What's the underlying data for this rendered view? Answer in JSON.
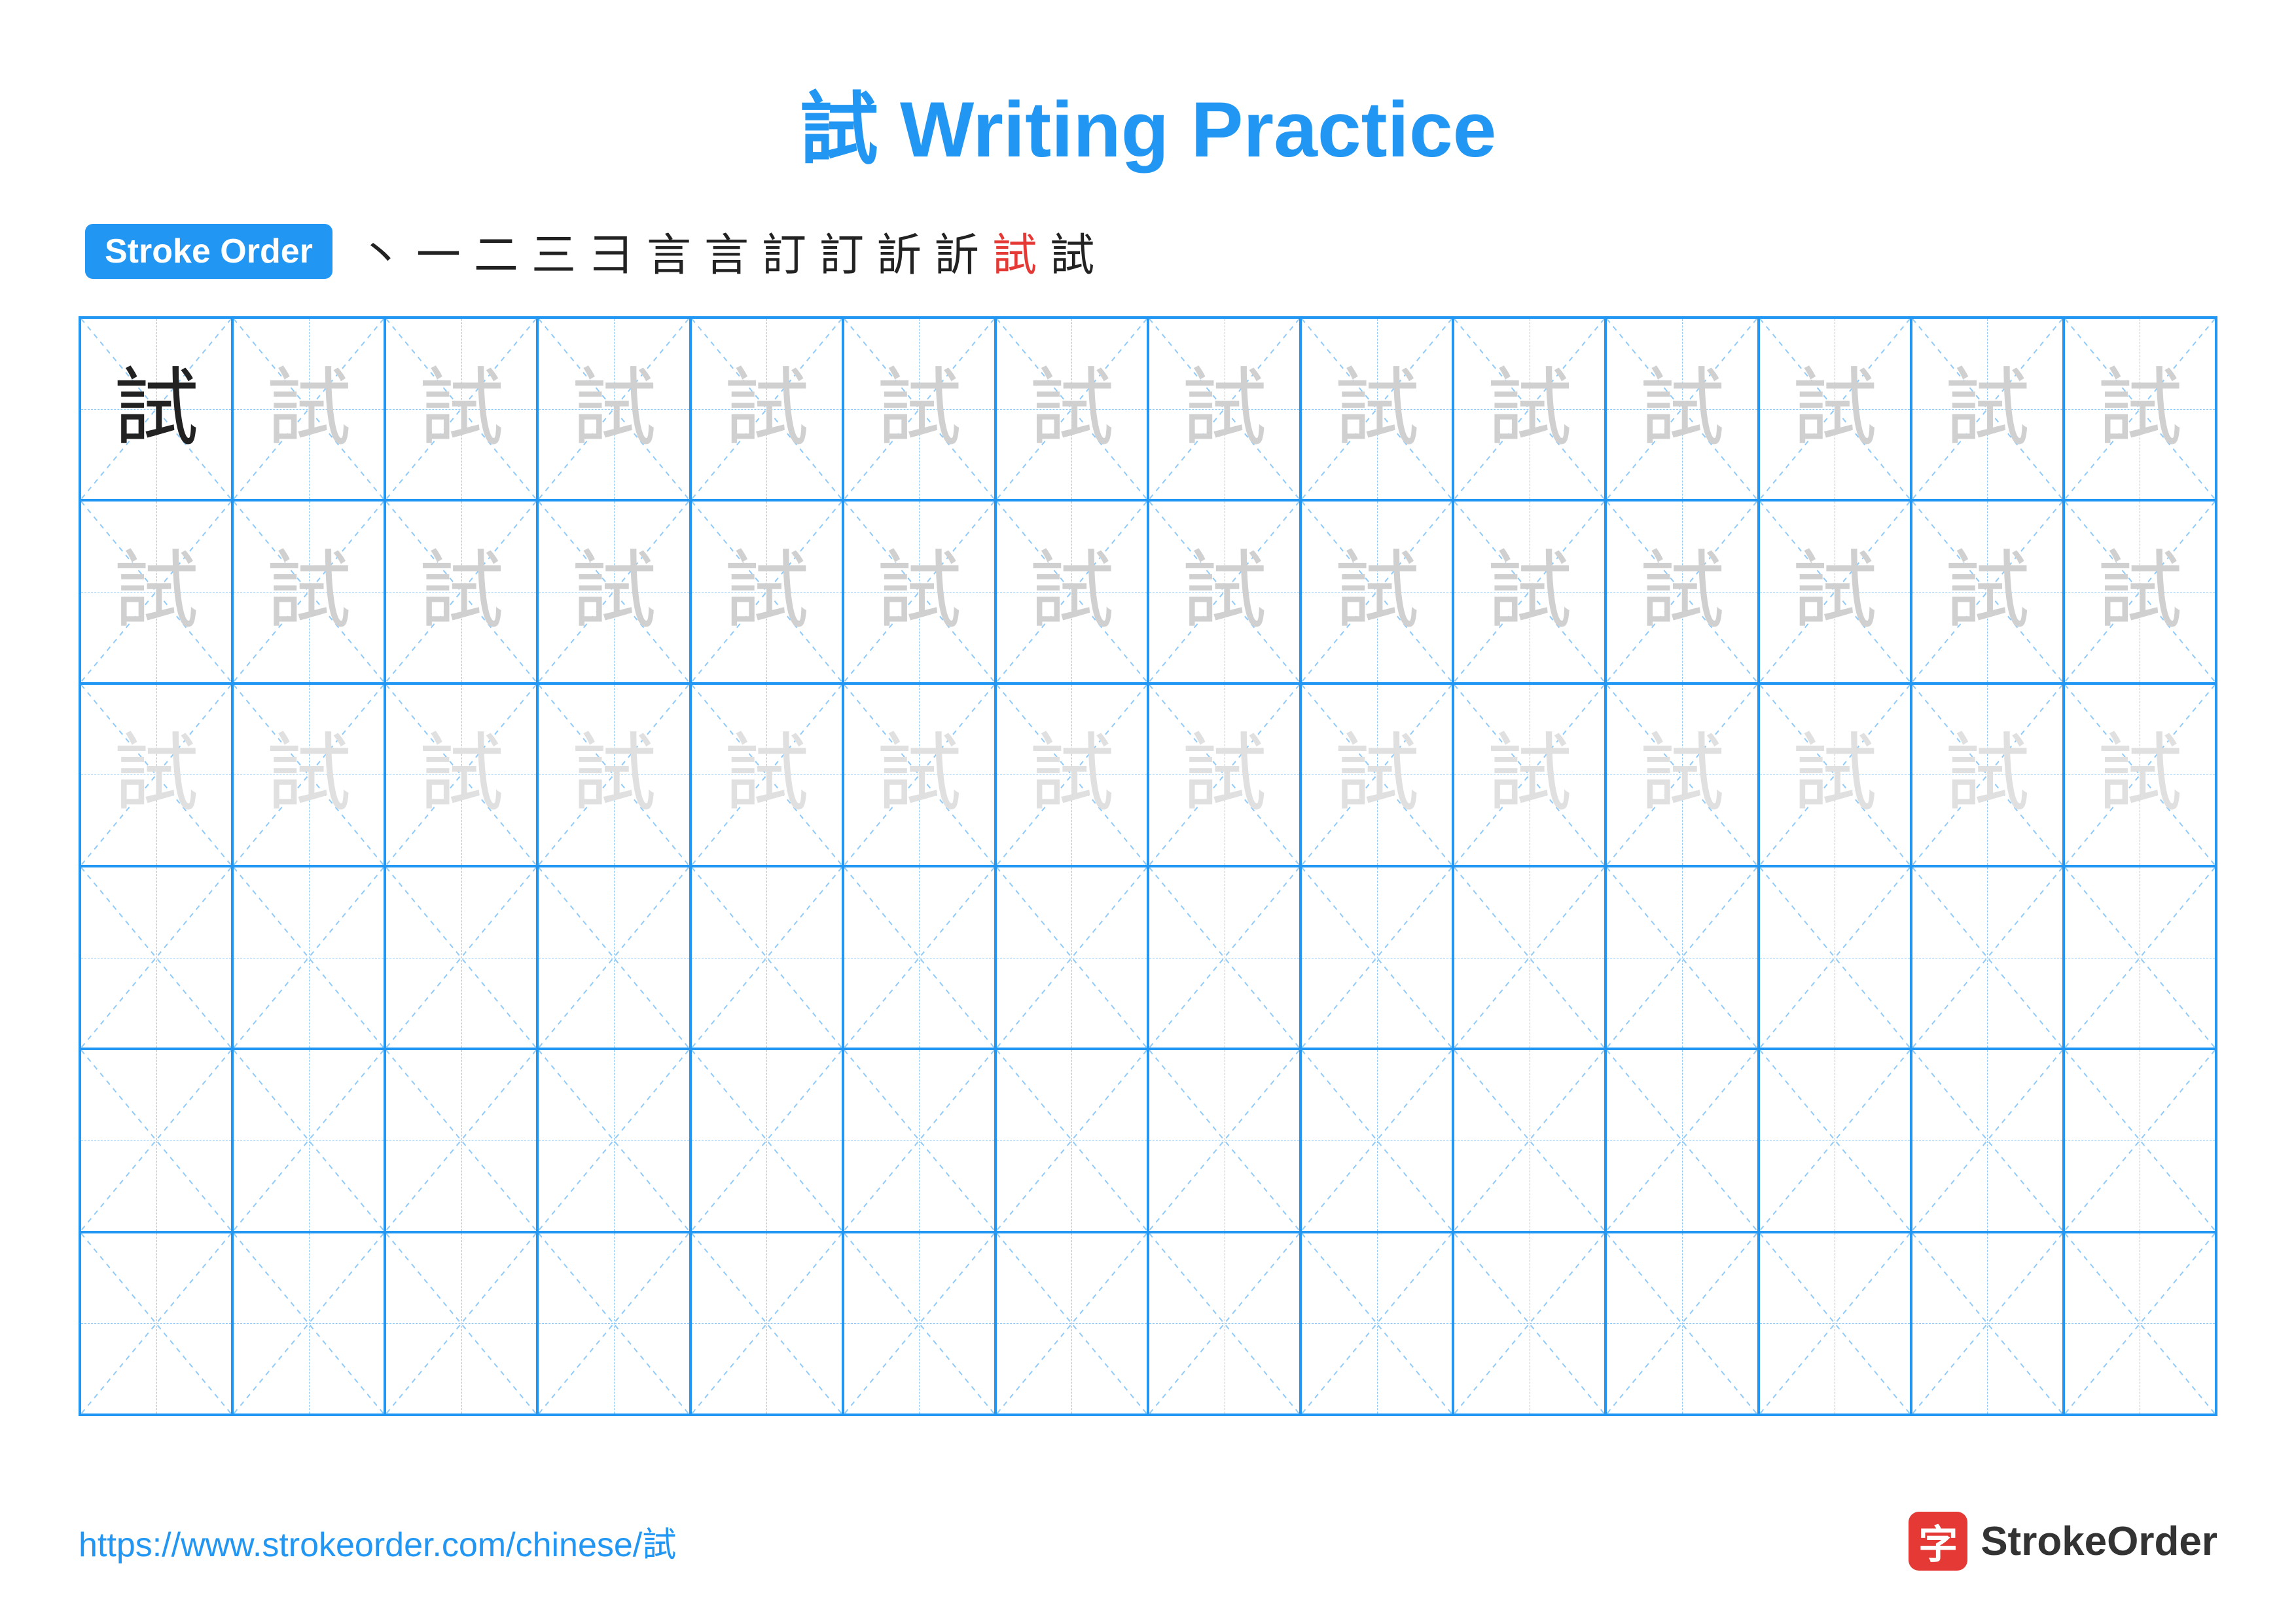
{
  "title": {
    "char": "試",
    "text": " Writing Practice"
  },
  "stroke_order": {
    "badge_label": "Stroke Order",
    "strokes": [
      "丶",
      "一",
      "二",
      "三",
      "彐",
      "言",
      "言",
      "訂",
      "訂",
      "訢",
      "訢",
      "試",
      "試"
    ]
  },
  "grid": {
    "cols": 14,
    "rows": 6,
    "char": "試"
  },
  "footer": {
    "url": "https://www.strokeorder.com/chinese/試",
    "logo_char": "字",
    "logo_text": "StrokeOrder"
  }
}
